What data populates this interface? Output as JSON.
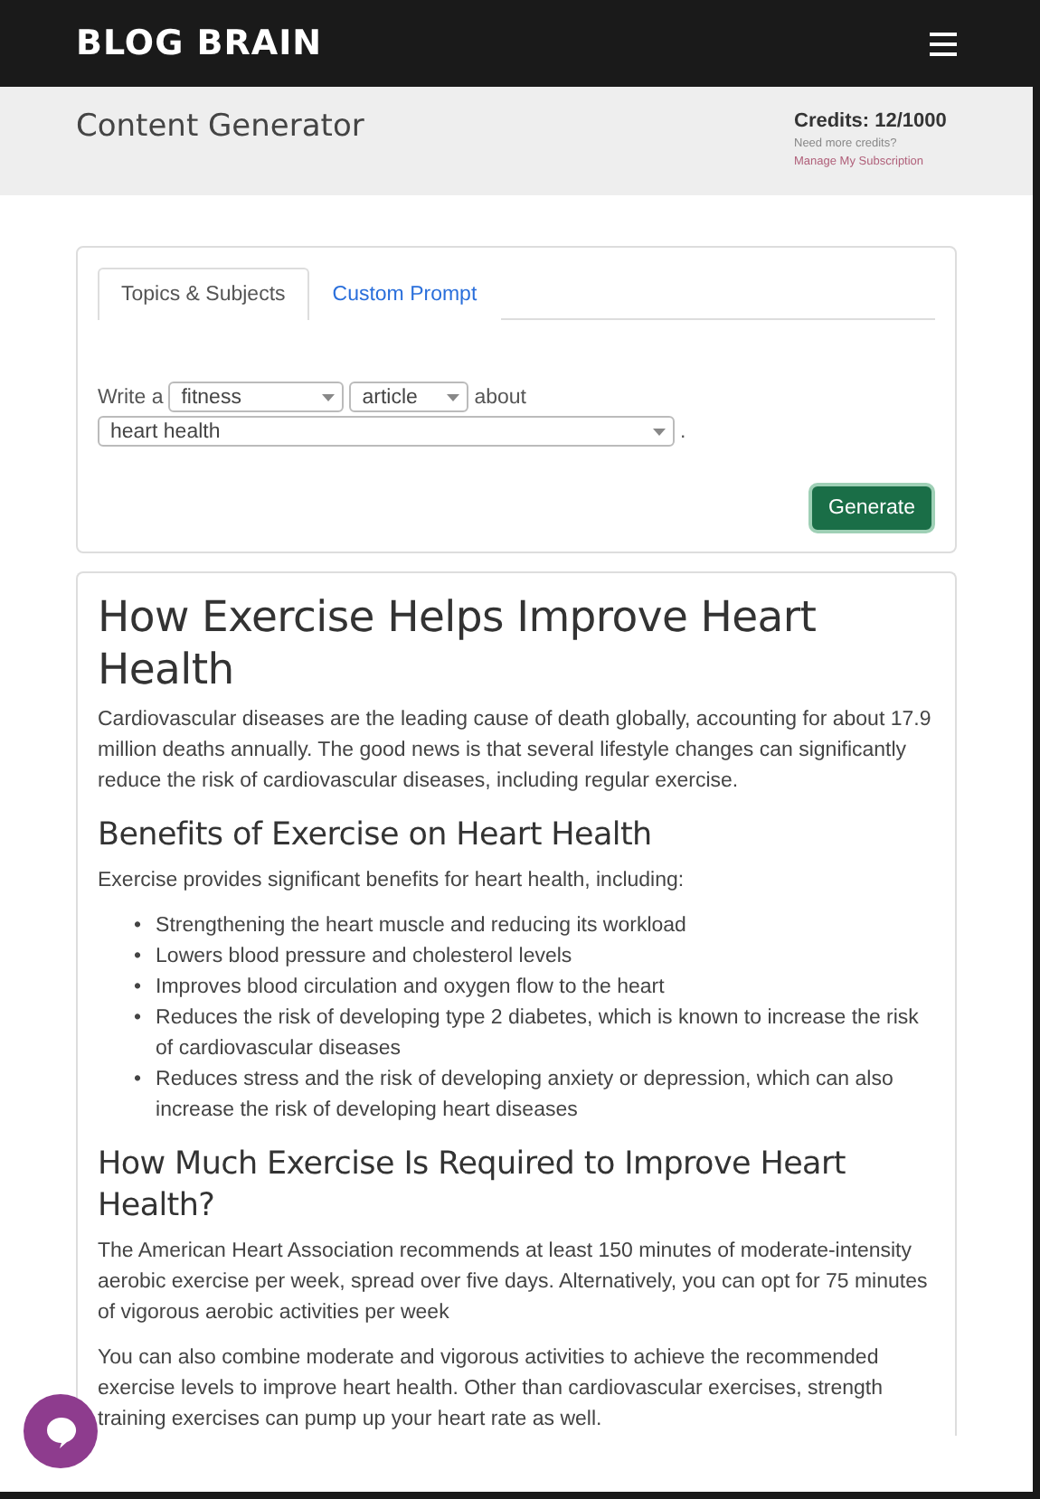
{
  "navbar": {
    "brand": "BLOG BRAIN"
  },
  "header": {
    "title": "Content Generator",
    "credits": "Credits: 12/1000",
    "credits_hint": "Need more credits?",
    "subscription_link": "Manage My Subscription"
  },
  "tabs": [
    {
      "label": "Topics & Subjects",
      "selected": true
    },
    {
      "label": "Custom Prompt",
      "selected": false
    }
  ],
  "form": {
    "prefix": "Write a",
    "niche": "fitness",
    "type": "article",
    "connector": "about",
    "topic": "heart health",
    "period": ".",
    "button": "Generate"
  },
  "article": [
    {
      "kind": "h1",
      "text": "How Exercise Helps Improve Heart Health"
    },
    {
      "kind": "p",
      "text": "Cardiovascular diseases are the leading cause of death globally, accounting for about 17.9 million deaths annually. The good news is that several lifestyle changes can significantly reduce the risk of cardiovascular diseases, including regular exercise."
    },
    {
      "kind": "h2",
      "text": "Benefits of Exercise on Heart Health"
    },
    {
      "kind": "p",
      "text": "Exercise provides significant benefits for heart health, including:"
    },
    {
      "kind": "ul",
      "items": [
        {
          "bullet": "•",
          "text": "Strengthening the heart muscle and reducing its workload"
        },
        {
          "bullet": "•",
          "text": "Lowers blood pressure and cholesterol levels"
        },
        {
          "bullet": "•",
          "text": "Improves blood circulation and oxygen flow to the heart"
        },
        {
          "bullet": "•",
          "text": "Reduces the risk of developing type 2 diabetes, which is known to increase the risk of cardiovascular diseases"
        },
        {
          "bullet": "•",
          "text": "Reduces stress and the risk of developing anxiety or depression, which can also increase the risk of developing heart diseases"
        }
      ]
    },
    {
      "kind": "h2",
      "text": "How Much Exercise Is Required to Improve Heart Health?"
    },
    {
      "kind": "p",
      "text": "The American Heart Association recommends at least 150 minutes of moderate-intensity aerobic exercise per week, spread over five days. Alternatively, you can opt for 75 minutes of vigorous aerobic activities per week"
    },
    {
      "kind": "p",
      "text": "You can also combine moderate and vigorous activities to achieve the recommended exercise levels to improve heart health. Other than cardiovascular exercises, strength training exercises can pump up your heart rate as well."
    }
  ]
}
